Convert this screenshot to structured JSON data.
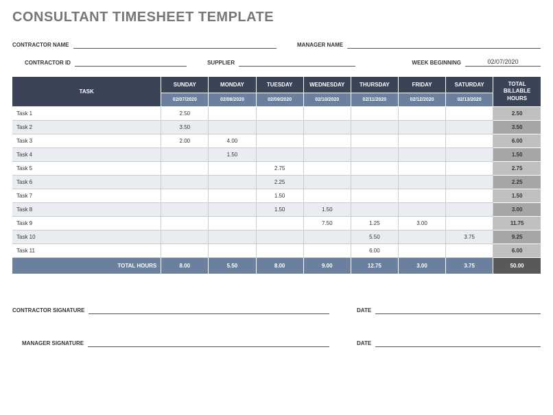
{
  "title": "CONSULTANT TIMESHEET TEMPLATE",
  "labels": {
    "contractor_name": "CONTRACTOR NAME",
    "manager_name": "MANAGER NAME",
    "contractor_id": "CONTRACTOR ID",
    "supplier": "SUPPLIER",
    "week_beginning": "WEEK BEGINNING",
    "contractor_signature": "CONTRACTOR SIGNATURE",
    "manager_signature": "MANAGER SIGNATURE",
    "date": "DATE",
    "task": "TASK",
    "total_hours": "TOTAL HOURS",
    "total_billable_hours": "TOTAL BILLABLE HOURS"
  },
  "week_beginning_value": "02/07/2020",
  "days": [
    {
      "name": "SUNDAY",
      "date": "02/07/2020"
    },
    {
      "name": "MONDAY",
      "date": "02/08/2020"
    },
    {
      "name": "TUESDAY",
      "date": "02/09/2020"
    },
    {
      "name": "WEDNESDAY",
      "date": "02/10/2020"
    },
    {
      "name": "THURSDAY",
      "date": "02/11/2020"
    },
    {
      "name": "FRIDAY",
      "date": "02/12/2020"
    },
    {
      "name": "SATURDAY",
      "date": "02/13/2020"
    }
  ],
  "tasks": [
    {
      "name": "Task 1",
      "hours": [
        "2.50",
        "",
        "",
        "",
        "",
        "",
        ""
      ],
      "total": "2.50"
    },
    {
      "name": "Task 2",
      "hours": [
        "3.50",
        "",
        "",
        "",
        "",
        "",
        ""
      ],
      "total": "3.50"
    },
    {
      "name": "Task 3",
      "hours": [
        "2.00",
        "4.00",
        "",
        "",
        "",
        "",
        ""
      ],
      "total": "6.00"
    },
    {
      "name": "Task 4",
      "hours": [
        "",
        "1.50",
        "",
        "",
        "",
        "",
        ""
      ],
      "total": "1.50"
    },
    {
      "name": "Task 5",
      "hours": [
        "",
        "",
        "2.75",
        "",
        "",
        "",
        ""
      ],
      "total": "2.75"
    },
    {
      "name": "Task 6",
      "hours": [
        "",
        "",
        "2.25",
        "",
        "",
        "",
        ""
      ],
      "total": "2.25"
    },
    {
      "name": "Task 7",
      "hours": [
        "",
        "",
        "1.50",
        "",
        "",
        "",
        ""
      ],
      "total": "1.50"
    },
    {
      "name": "Task 8",
      "hours": [
        "",
        "",
        "1.50",
        "1.50",
        "",
        "",
        ""
      ],
      "total": "3.00"
    },
    {
      "name": "Task 9",
      "hours": [
        "",
        "",
        "",
        "7.50",
        "1.25",
        "3.00",
        ""
      ],
      "total": "11.75"
    },
    {
      "name": "Task 10",
      "hours": [
        "",
        "",
        "",
        "",
        "5.50",
        "",
        "3.75"
      ],
      "total": "9.25"
    },
    {
      "name": "Task 11",
      "hours": [
        "",
        "",
        "",
        "",
        "6.00",
        "",
        ""
      ],
      "total": "6.00"
    }
  ],
  "day_totals": [
    "8.00",
    "5.50",
    "8.00",
    "9.00",
    "12.75",
    "3.00",
    "3.75"
  ],
  "grand_total": "50.00"
}
